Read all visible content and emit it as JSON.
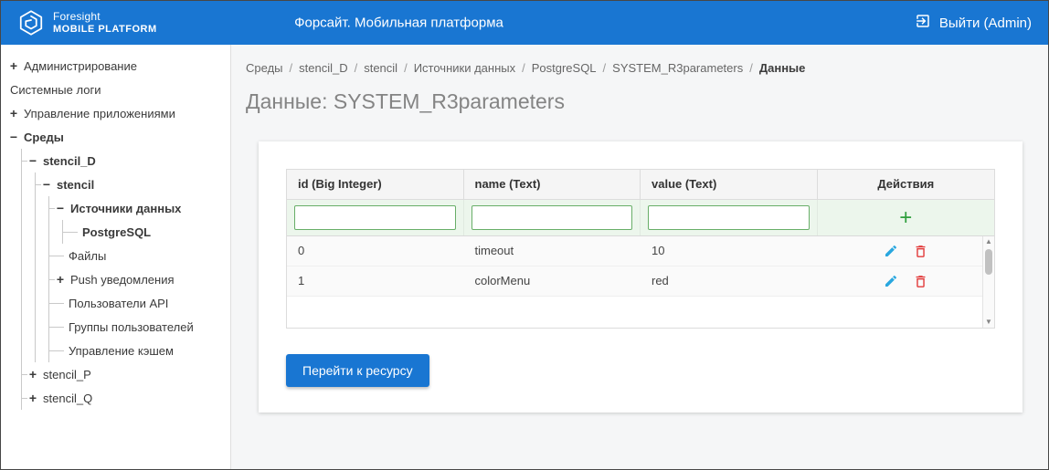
{
  "header": {
    "logo": {
      "line1": "Foresight",
      "line2": "MOBILE PLATFORM"
    },
    "title": "Форсайт. Мобильная платформа",
    "logout_label": "Выйти (Admin)"
  },
  "sidebar": {
    "items": [
      {
        "label": "Администрирование",
        "toggle": "+"
      },
      {
        "label": "Системные логи",
        "toggle": ""
      },
      {
        "label": "Управление приложениями",
        "toggle": "+"
      },
      {
        "label": "Среды",
        "toggle": "−"
      },
      {
        "label": "stencil_D",
        "toggle": "−"
      },
      {
        "label": "stencil",
        "toggle": "−"
      },
      {
        "label": "Источники данных",
        "toggle": "−"
      },
      {
        "label": "PostgreSQL",
        "toggle": ""
      },
      {
        "label": "Файлы",
        "toggle": ""
      },
      {
        "label": "Push уведомления",
        "toggle": "+"
      },
      {
        "label": "Пользователи API",
        "toggle": ""
      },
      {
        "label": "Группы пользователей",
        "toggle": ""
      },
      {
        "label": "Управление кэшем",
        "toggle": ""
      },
      {
        "label": "stencil_P",
        "toggle": "+"
      },
      {
        "label": "stencil_Q",
        "toggle": "+"
      }
    ]
  },
  "breadcrumb": {
    "separator": "/",
    "items": [
      "Среды",
      "stencil_D",
      "stencil",
      "Источники данных",
      "PostgreSQL",
      "SYSTEM_R3parameters",
      "Данные"
    ]
  },
  "page": {
    "title": "Данные: SYSTEM_R3parameters"
  },
  "table": {
    "columns": [
      "id (Big Integer)",
      "name (Text)",
      "value (Text)",
      "Действия"
    ],
    "filter_values": [
      "",
      "",
      ""
    ],
    "rows": [
      {
        "id": "0",
        "name": "timeout",
        "value": "10"
      },
      {
        "id": "1",
        "name": "colorMenu",
        "value": "red"
      }
    ]
  },
  "icons": {
    "add": "+",
    "scroll_up": "▲",
    "scroll_down": "▼"
  },
  "buttons": {
    "go_to_resource": "Перейти к ресурсу"
  },
  "colors": {
    "header_blue": "#1976d2",
    "accent_green": "#2e9e3c",
    "edit_blue": "#29a7df",
    "delete_red": "#e23b3b"
  }
}
